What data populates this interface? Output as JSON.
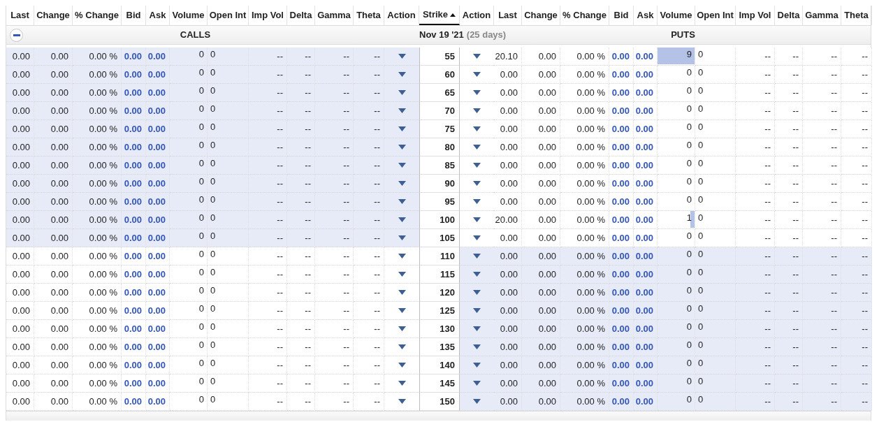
{
  "columns": [
    {
      "label": "Last",
      "sorted": false
    },
    {
      "label": "Change",
      "sorted": false
    },
    {
      "label": "% Change",
      "sorted": false
    },
    {
      "label": "Bid",
      "sorted": false
    },
    {
      "label": "Ask",
      "sorted": false
    },
    {
      "label": "Volume",
      "sorted": false
    },
    {
      "label": "Open Int",
      "sorted": false
    },
    {
      "label": "Imp Vol",
      "sorted": false
    },
    {
      "label": "Delta",
      "sorted": false
    },
    {
      "label": "Gamma",
      "sorted": false
    },
    {
      "label": "Theta",
      "sorted": false
    },
    {
      "label": "Action",
      "sorted": false
    },
    {
      "label": "Strike",
      "sorted": true
    },
    {
      "label": "Action",
      "sorted": false
    },
    {
      "label": "Last",
      "sorted": false
    },
    {
      "label": "Change",
      "sorted": false
    },
    {
      "label": "% Change",
      "sorted": false
    },
    {
      "label": "Bid",
      "sorted": false
    },
    {
      "label": "Ask",
      "sorted": false
    },
    {
      "label": "Volume",
      "sorted": false
    },
    {
      "label": "Open Int",
      "sorted": false
    },
    {
      "label": "Imp Vol",
      "sorted": false
    },
    {
      "label": "Delta",
      "sorted": false
    },
    {
      "label": "Gamma",
      "sorted": false
    },
    {
      "label": "Theta",
      "sorted": false
    }
  ],
  "section": {
    "expanded": true,
    "calls_label": "CALLS",
    "date": "Nov 19 '21",
    "days": "(25 days)",
    "puts_label": "PUTS"
  },
  "rows": [
    {
      "strike": "55",
      "calls": {
        "in_the_money": true,
        "last": "0.00",
        "change": "0.00",
        "pct_change": "0.00 %",
        "bid": "0.00",
        "ask": "0.00",
        "volume": {
          "text": "0",
          "level": 0
        },
        "open_int": "0",
        "imp_vol": "--",
        "delta": "--",
        "gamma": "--",
        "theta": "--"
      },
      "puts": {
        "in_the_money": false,
        "last": "20.10",
        "change": "0.00",
        "pct_change": "0.00 %",
        "bid": "0.00",
        "ask": "0.00",
        "volume": {
          "text": "9",
          "level": 1
        },
        "open_int": "0",
        "imp_vol": "--",
        "delta": "--",
        "gamma": "--",
        "theta": "--"
      }
    },
    {
      "strike": "60",
      "calls": {
        "in_the_money": true,
        "last": "0.00",
        "change": "0.00",
        "pct_change": "0.00 %",
        "bid": "0.00",
        "ask": "0.00",
        "volume": {
          "text": "0",
          "level": 0
        },
        "open_int": "0",
        "imp_vol": "--",
        "delta": "--",
        "gamma": "--",
        "theta": "--"
      },
      "puts": {
        "in_the_money": false,
        "last": "0.00",
        "change": "0.00",
        "pct_change": "0.00 %",
        "bid": "0.00",
        "ask": "0.00",
        "volume": {
          "text": "0",
          "level": 0
        },
        "open_int": "0",
        "imp_vol": "--",
        "delta": "--",
        "gamma": "--",
        "theta": "--"
      }
    },
    {
      "strike": "65",
      "calls": {
        "in_the_money": true,
        "last": "0.00",
        "change": "0.00",
        "pct_change": "0.00 %",
        "bid": "0.00",
        "ask": "0.00",
        "volume": {
          "text": "0",
          "level": 0
        },
        "open_int": "0",
        "imp_vol": "--",
        "delta": "--",
        "gamma": "--",
        "theta": "--"
      },
      "puts": {
        "in_the_money": false,
        "last": "0.00",
        "change": "0.00",
        "pct_change": "0.00 %",
        "bid": "0.00",
        "ask": "0.00",
        "volume": {
          "text": "0",
          "level": 0
        },
        "open_int": "0",
        "imp_vol": "--",
        "delta": "--",
        "gamma": "--",
        "theta": "--"
      }
    },
    {
      "strike": "70",
      "calls": {
        "in_the_money": true,
        "last": "0.00",
        "change": "0.00",
        "pct_change": "0.00 %",
        "bid": "0.00",
        "ask": "0.00",
        "volume": {
          "text": "0",
          "level": 0
        },
        "open_int": "0",
        "imp_vol": "--",
        "delta": "--",
        "gamma": "--",
        "theta": "--"
      },
      "puts": {
        "in_the_money": false,
        "last": "0.00",
        "change": "0.00",
        "pct_change": "0.00 %",
        "bid": "0.00",
        "ask": "0.00",
        "volume": {
          "text": "0",
          "level": 0
        },
        "open_int": "0",
        "imp_vol": "--",
        "delta": "--",
        "gamma": "--",
        "theta": "--"
      }
    },
    {
      "strike": "75",
      "calls": {
        "in_the_money": true,
        "last": "0.00",
        "change": "0.00",
        "pct_change": "0.00 %",
        "bid": "0.00",
        "ask": "0.00",
        "volume": {
          "text": "0",
          "level": 0
        },
        "open_int": "0",
        "imp_vol": "--",
        "delta": "--",
        "gamma": "--",
        "theta": "--"
      },
      "puts": {
        "in_the_money": false,
        "last": "0.00",
        "change": "0.00",
        "pct_change": "0.00 %",
        "bid": "0.00",
        "ask": "0.00",
        "volume": {
          "text": "0",
          "level": 0
        },
        "open_int": "0",
        "imp_vol": "--",
        "delta": "--",
        "gamma": "--",
        "theta": "--"
      }
    },
    {
      "strike": "80",
      "calls": {
        "in_the_money": true,
        "last": "0.00",
        "change": "0.00",
        "pct_change": "0.00 %",
        "bid": "0.00",
        "ask": "0.00",
        "volume": {
          "text": "0",
          "level": 0
        },
        "open_int": "0",
        "imp_vol": "--",
        "delta": "--",
        "gamma": "--",
        "theta": "--"
      },
      "puts": {
        "in_the_money": false,
        "last": "0.00",
        "change": "0.00",
        "pct_change": "0.00 %",
        "bid": "0.00",
        "ask": "0.00",
        "volume": {
          "text": "0",
          "level": 0
        },
        "open_int": "0",
        "imp_vol": "--",
        "delta": "--",
        "gamma": "--",
        "theta": "--"
      }
    },
    {
      "strike": "85",
      "calls": {
        "in_the_money": true,
        "last": "0.00",
        "change": "0.00",
        "pct_change": "0.00 %",
        "bid": "0.00",
        "ask": "0.00",
        "volume": {
          "text": "0",
          "level": 0
        },
        "open_int": "0",
        "imp_vol": "--",
        "delta": "--",
        "gamma": "--",
        "theta": "--"
      },
      "puts": {
        "in_the_money": false,
        "last": "0.00",
        "change": "0.00",
        "pct_change": "0.00 %",
        "bid": "0.00",
        "ask": "0.00",
        "volume": {
          "text": "0",
          "level": 0
        },
        "open_int": "0",
        "imp_vol": "--",
        "delta": "--",
        "gamma": "--",
        "theta": "--"
      }
    },
    {
      "strike": "90",
      "calls": {
        "in_the_money": true,
        "last": "0.00",
        "change": "0.00",
        "pct_change": "0.00 %",
        "bid": "0.00",
        "ask": "0.00",
        "volume": {
          "text": "0",
          "level": 0
        },
        "open_int": "0",
        "imp_vol": "--",
        "delta": "--",
        "gamma": "--",
        "theta": "--"
      },
      "puts": {
        "in_the_money": false,
        "last": "0.00",
        "change": "0.00",
        "pct_change": "0.00 %",
        "bid": "0.00",
        "ask": "0.00",
        "volume": {
          "text": "0",
          "level": 0
        },
        "open_int": "0",
        "imp_vol": "--",
        "delta": "--",
        "gamma": "--",
        "theta": "--"
      }
    },
    {
      "strike": "95",
      "calls": {
        "in_the_money": true,
        "last": "0.00",
        "change": "0.00",
        "pct_change": "0.00 %",
        "bid": "0.00",
        "ask": "0.00",
        "volume": {
          "text": "0",
          "level": 0
        },
        "open_int": "0",
        "imp_vol": "--",
        "delta": "--",
        "gamma": "--",
        "theta": "--"
      },
      "puts": {
        "in_the_money": false,
        "last": "0.00",
        "change": "0.00",
        "pct_change": "0.00 %",
        "bid": "0.00",
        "ask": "0.00",
        "volume": {
          "text": "0",
          "level": 0
        },
        "open_int": "0",
        "imp_vol": "--",
        "delta": "--",
        "gamma": "--",
        "theta": "--"
      }
    },
    {
      "strike": "100",
      "calls": {
        "in_the_money": true,
        "last": "0.00",
        "change": "0.00",
        "pct_change": "0.00 %",
        "bid": "0.00",
        "ask": "0.00",
        "volume": {
          "text": "0",
          "level": 0
        },
        "open_int": "0",
        "imp_vol": "--",
        "delta": "--",
        "gamma": "--",
        "theta": "--"
      },
      "puts": {
        "in_the_money": false,
        "last": "20.00",
        "change": "0.00",
        "pct_change": "0.00 %",
        "bid": "0.00",
        "ask": "0.00",
        "volume": {
          "text": "1",
          "level": 0.11
        },
        "open_int": "0",
        "imp_vol": "--",
        "delta": "--",
        "gamma": "--",
        "theta": "--"
      }
    },
    {
      "strike": "105",
      "calls": {
        "in_the_money": true,
        "last": "0.00",
        "change": "0.00",
        "pct_change": "0.00 %",
        "bid": "0.00",
        "ask": "0.00",
        "volume": {
          "text": "0",
          "level": 0
        },
        "open_int": "0",
        "imp_vol": "--",
        "delta": "--",
        "gamma": "--",
        "theta": "--"
      },
      "puts": {
        "in_the_money": false,
        "last": "0.00",
        "change": "0.00",
        "pct_change": "0.00 %",
        "bid": "0.00",
        "ask": "0.00",
        "volume": {
          "text": "0",
          "level": 0
        },
        "open_int": "0",
        "imp_vol": "--",
        "delta": "--",
        "gamma": "--",
        "theta": "--"
      }
    },
    {
      "strike": "110",
      "calls": {
        "in_the_money": false,
        "last": "0.00",
        "change": "0.00",
        "pct_change": "0.00 %",
        "bid": "0.00",
        "ask": "0.00",
        "volume": {
          "text": "0",
          "level": 0
        },
        "open_int": "0",
        "imp_vol": "--",
        "delta": "--",
        "gamma": "--",
        "theta": "--"
      },
      "puts": {
        "in_the_money": true,
        "last": "0.00",
        "change": "0.00",
        "pct_change": "0.00 %",
        "bid": "0.00",
        "ask": "0.00",
        "volume": {
          "text": "0",
          "level": 0
        },
        "open_int": "0",
        "imp_vol": "--",
        "delta": "--",
        "gamma": "--",
        "theta": "--"
      }
    },
    {
      "strike": "115",
      "calls": {
        "in_the_money": false,
        "last": "0.00",
        "change": "0.00",
        "pct_change": "0.00 %",
        "bid": "0.00",
        "ask": "0.00",
        "volume": {
          "text": "0",
          "level": 0
        },
        "open_int": "0",
        "imp_vol": "--",
        "delta": "--",
        "gamma": "--",
        "theta": "--"
      },
      "puts": {
        "in_the_money": true,
        "last": "0.00",
        "change": "0.00",
        "pct_change": "0.00 %",
        "bid": "0.00",
        "ask": "0.00",
        "volume": {
          "text": "0",
          "level": 0
        },
        "open_int": "0",
        "imp_vol": "--",
        "delta": "--",
        "gamma": "--",
        "theta": "--"
      }
    },
    {
      "strike": "120",
      "calls": {
        "in_the_money": false,
        "last": "0.00",
        "change": "0.00",
        "pct_change": "0.00 %",
        "bid": "0.00",
        "ask": "0.00",
        "volume": {
          "text": "0",
          "level": 0
        },
        "open_int": "0",
        "imp_vol": "--",
        "delta": "--",
        "gamma": "--",
        "theta": "--"
      },
      "puts": {
        "in_the_money": true,
        "last": "0.00",
        "change": "0.00",
        "pct_change": "0.00 %",
        "bid": "0.00",
        "ask": "0.00",
        "volume": {
          "text": "0",
          "level": 0
        },
        "open_int": "0",
        "imp_vol": "--",
        "delta": "--",
        "gamma": "--",
        "theta": "--"
      }
    },
    {
      "strike": "125",
      "calls": {
        "in_the_money": false,
        "last": "0.00",
        "change": "0.00",
        "pct_change": "0.00 %",
        "bid": "0.00",
        "ask": "0.00",
        "volume": {
          "text": "0",
          "level": 0
        },
        "open_int": "0",
        "imp_vol": "--",
        "delta": "--",
        "gamma": "--",
        "theta": "--"
      },
      "puts": {
        "in_the_money": true,
        "last": "0.00",
        "change": "0.00",
        "pct_change": "0.00 %",
        "bid": "0.00",
        "ask": "0.00",
        "volume": {
          "text": "0",
          "level": 0
        },
        "open_int": "0",
        "imp_vol": "--",
        "delta": "--",
        "gamma": "--",
        "theta": "--"
      }
    },
    {
      "strike": "130",
      "calls": {
        "in_the_money": false,
        "last": "0.00",
        "change": "0.00",
        "pct_change": "0.00 %",
        "bid": "0.00",
        "ask": "0.00",
        "volume": {
          "text": "0",
          "level": 0
        },
        "open_int": "0",
        "imp_vol": "--",
        "delta": "--",
        "gamma": "--",
        "theta": "--"
      },
      "puts": {
        "in_the_money": true,
        "last": "0.00",
        "change": "0.00",
        "pct_change": "0.00 %",
        "bid": "0.00",
        "ask": "0.00",
        "volume": {
          "text": "0",
          "level": 0
        },
        "open_int": "0",
        "imp_vol": "--",
        "delta": "--",
        "gamma": "--",
        "theta": "--"
      }
    },
    {
      "strike": "135",
      "calls": {
        "in_the_money": false,
        "last": "0.00",
        "change": "0.00",
        "pct_change": "0.00 %",
        "bid": "0.00",
        "ask": "0.00",
        "volume": {
          "text": "0",
          "level": 0
        },
        "open_int": "0",
        "imp_vol": "--",
        "delta": "--",
        "gamma": "--",
        "theta": "--"
      },
      "puts": {
        "in_the_money": true,
        "last": "0.00",
        "change": "0.00",
        "pct_change": "0.00 %",
        "bid": "0.00",
        "ask": "0.00",
        "volume": {
          "text": "0",
          "level": 0
        },
        "open_int": "0",
        "imp_vol": "--",
        "delta": "--",
        "gamma": "--",
        "theta": "--"
      }
    },
    {
      "strike": "140",
      "calls": {
        "in_the_money": false,
        "last": "0.00",
        "change": "0.00",
        "pct_change": "0.00 %",
        "bid": "0.00",
        "ask": "0.00",
        "volume": {
          "text": "0",
          "level": 0
        },
        "open_int": "0",
        "imp_vol": "--",
        "delta": "--",
        "gamma": "--",
        "theta": "--"
      },
      "puts": {
        "in_the_money": true,
        "last": "0.00",
        "change": "0.00",
        "pct_change": "0.00 %",
        "bid": "0.00",
        "ask": "0.00",
        "volume": {
          "text": "0",
          "level": 0
        },
        "open_int": "0",
        "imp_vol": "--",
        "delta": "--",
        "gamma": "--",
        "theta": "--"
      }
    },
    {
      "strike": "145",
      "calls": {
        "in_the_money": false,
        "last": "0.00",
        "change": "0.00",
        "pct_change": "0.00 %",
        "bid": "0.00",
        "ask": "0.00",
        "volume": {
          "text": "0",
          "level": 0
        },
        "open_int": "0",
        "imp_vol": "--",
        "delta": "--",
        "gamma": "--",
        "theta": "--"
      },
      "puts": {
        "in_the_money": true,
        "last": "0.00",
        "change": "0.00",
        "pct_change": "0.00 %",
        "bid": "0.00",
        "ask": "0.00",
        "volume": {
          "text": "0",
          "level": 0
        },
        "open_int": "0",
        "imp_vol": "--",
        "delta": "--",
        "gamma": "--",
        "theta": "--"
      }
    },
    {
      "strike": "150",
      "calls": {
        "in_the_money": false,
        "last": "0.00",
        "change": "0.00",
        "pct_change": "0.00 %",
        "bid": "0.00",
        "ask": "0.00",
        "volume": {
          "text": "0",
          "level": 0
        },
        "open_int": "0",
        "imp_vol": "--",
        "delta": "--",
        "gamma": "--",
        "theta": "--"
      },
      "puts": {
        "in_the_money": true,
        "last": "0.00",
        "change": "0.00",
        "pct_change": "0.00 %",
        "bid": "0.00",
        "ask": "0.00",
        "volume": {
          "text": "0",
          "level": 0
        },
        "open_int": "0",
        "imp_vol": "--",
        "delta": "--",
        "gamma": "--",
        "theta": "--"
      }
    }
  ]
}
